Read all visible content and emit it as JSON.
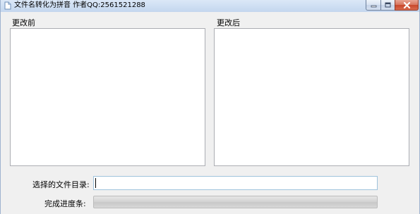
{
  "window": {
    "title": "文件名转化为拼音 作者QQ:2561521288"
  },
  "panels": {
    "before_label": "更改前",
    "after_label": "更改后"
  },
  "form": {
    "dir_label": "选择的文件目录:",
    "dir_value": "",
    "progress_label": "完成进度条:",
    "progress_percent": 0
  },
  "colors": {
    "titlebar": "#cfdff3",
    "window_bg": "#f0f0f0",
    "close_button": "#c8472b"
  }
}
